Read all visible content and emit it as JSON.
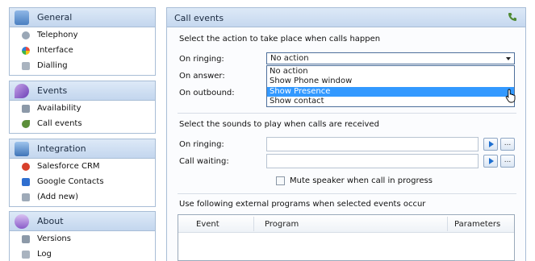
{
  "sidebar": {
    "groups": [
      {
        "title": "General",
        "icon": "general-icon",
        "items": [
          {
            "label": "Telephony",
            "icon": "telephony-icon"
          },
          {
            "label": "Interface",
            "icon": "interface-icon"
          },
          {
            "label": "Dialling",
            "icon": "dialling-icon"
          }
        ]
      },
      {
        "title": "Events",
        "icon": "events-icon",
        "items": [
          {
            "label": "Availability",
            "icon": "availability-icon"
          },
          {
            "label": "Call events",
            "icon": "call-events-icon"
          }
        ]
      },
      {
        "title": "Integration",
        "icon": "integration-icon",
        "items": [
          {
            "label": "Salesforce CRM",
            "icon": "salesforce-icon"
          },
          {
            "label": "Google Contacts",
            "icon": "google-contacts-icon"
          },
          {
            "label": "(Add new)",
            "icon": "add-new-icon"
          }
        ]
      },
      {
        "title": "About",
        "icon": "about-icon",
        "items": [
          {
            "label": "Versions",
            "icon": "versions-icon"
          },
          {
            "label": "Log",
            "icon": "log-icon"
          }
        ]
      }
    ]
  },
  "panel": {
    "title": "Call events",
    "actions_heading": "Select the action to take place when calls happen",
    "on_ringing_label": "On ringing:",
    "on_answer_label": "On answer:",
    "on_outbound_label": "On outbound:",
    "ringing_action_value": "No action",
    "dropdown_options": [
      "No action",
      "Show Phone window",
      "Show Presence",
      "Show contact"
    ],
    "highlighted_option": "Show Presence",
    "sounds_heading": "Select the sounds to play when calls are received",
    "sound_ringing_label": "On ringing:",
    "sound_waiting_label": "Call waiting:",
    "sound_ringing_value": "",
    "sound_waiting_value": "",
    "browse_label": "...",
    "mute_label": "Mute speaker when call in progress",
    "mute_checked": false,
    "programs_heading": "Use following external programs when selected events occur",
    "table_columns": [
      "Event",
      "Program",
      "Parameters"
    ]
  },
  "colors": {
    "header_gradient_top": "#dde9f7",
    "header_gradient_bottom": "#c3d6ee",
    "border": "#a8bdd6",
    "selection": "#3399ff"
  }
}
